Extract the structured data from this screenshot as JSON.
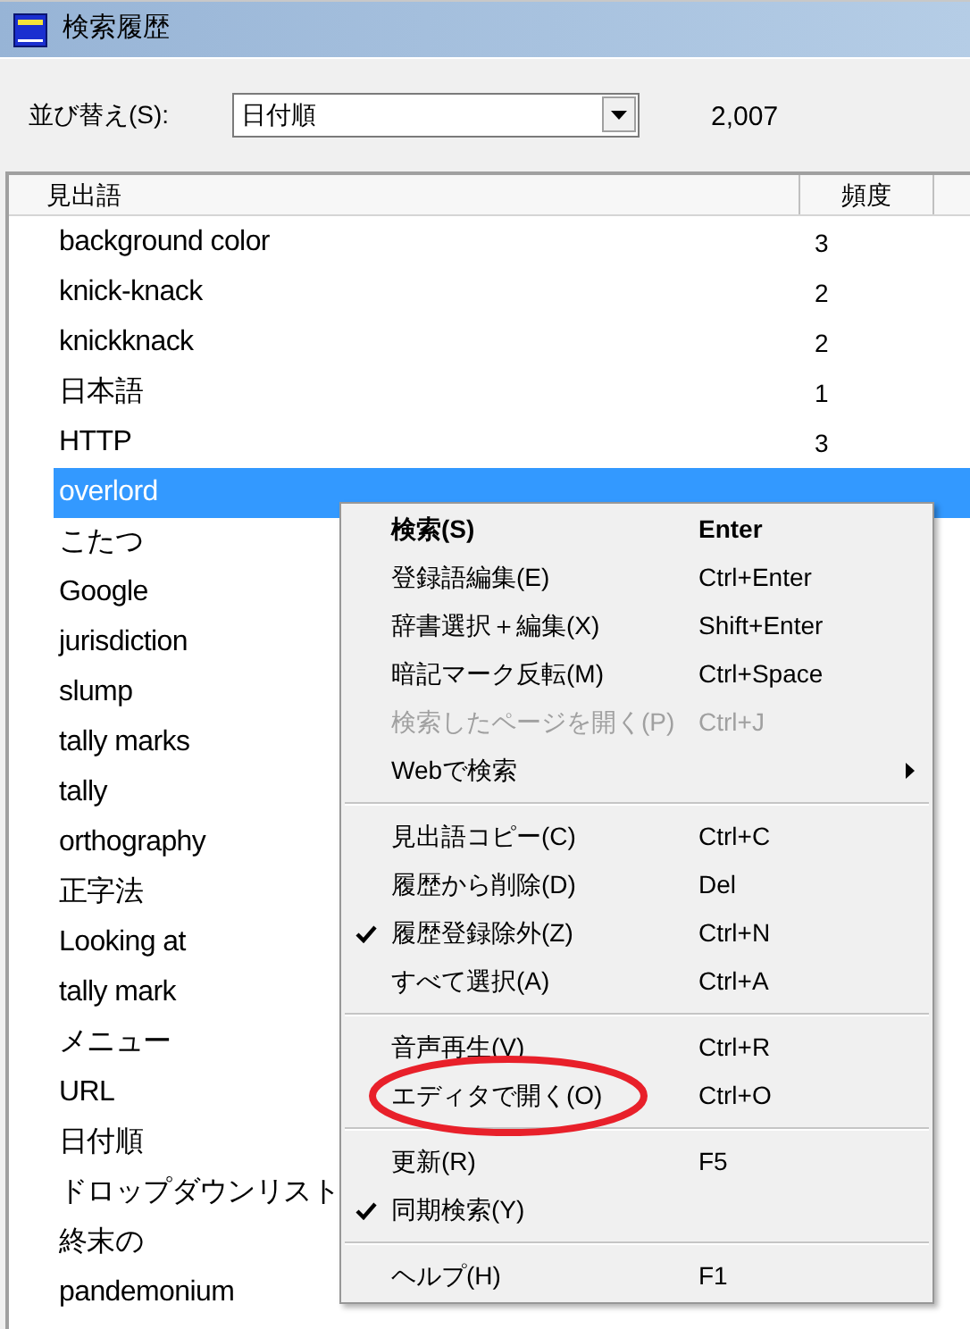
{
  "window": {
    "title": "検索履歴"
  },
  "sort": {
    "label": "並び替え(S):",
    "value": "日付順",
    "count": "2,007"
  },
  "table": {
    "columns": [
      "見出語",
      "頻度"
    ],
    "rows": [
      {
        "word": "background color",
        "freq": "3",
        "selected": false
      },
      {
        "word": "knick-knack",
        "freq": "2",
        "selected": false
      },
      {
        "word": "knickknack",
        "freq": "2",
        "selected": false
      },
      {
        "word": "日本語",
        "freq": "1",
        "selected": false
      },
      {
        "word": "HTTP",
        "freq": "3",
        "selected": false
      },
      {
        "word": "overlord",
        "selected": true
      },
      {
        "word": "こたつ",
        "selected": false
      },
      {
        "word": "Google",
        "selected": false
      },
      {
        "word": "jurisdiction",
        "selected": false
      },
      {
        "word": "slump",
        "selected": false
      },
      {
        "word": "tally marks",
        "selected": false
      },
      {
        "word": "tally",
        "selected": false
      },
      {
        "word": "orthography",
        "selected": false
      },
      {
        "word": "正字法",
        "selected": false
      },
      {
        "word": "Looking at",
        "selected": false
      },
      {
        "word": "tally mark",
        "selected": false
      },
      {
        "word": "メニュー",
        "selected": false
      },
      {
        "word": "URL",
        "selected": false
      },
      {
        "word": "日付順",
        "selected": false
      },
      {
        "word": "ドロップダウンリスト",
        "selected": false
      },
      {
        "word": "終末の",
        "selected": false
      },
      {
        "word": "pandemonium",
        "selected": false
      }
    ]
  },
  "context_menu": [
    {
      "kind": "item",
      "label": "検索(S)",
      "shortcut": "Enter",
      "default": true,
      "checked": false,
      "disabled": false,
      "submenu": false,
      "circled": false
    },
    {
      "kind": "item",
      "label": "登録語編集(E)",
      "shortcut": "Ctrl+Enter",
      "default": false,
      "checked": false,
      "disabled": false,
      "submenu": false,
      "circled": false
    },
    {
      "kind": "item",
      "label": "辞書選択＋編集(X)",
      "shortcut": "Shift+Enter",
      "default": false,
      "checked": false,
      "disabled": false,
      "submenu": false,
      "circled": false
    },
    {
      "kind": "item",
      "label": "暗記マーク反転(M)",
      "shortcut": "Ctrl+Space",
      "default": false,
      "checked": false,
      "disabled": false,
      "submenu": false,
      "circled": false
    },
    {
      "kind": "item",
      "label": "検索したページを開く(P)",
      "shortcut": "Ctrl+J",
      "default": false,
      "checked": false,
      "disabled": true,
      "submenu": false,
      "circled": false
    },
    {
      "kind": "item",
      "label": "Webで検索",
      "default": false,
      "checked": false,
      "disabled": false,
      "submenu": true,
      "circled": false
    },
    {
      "kind": "separator"
    },
    {
      "kind": "item",
      "label": "見出語コピー(C)",
      "shortcut": "Ctrl+C",
      "default": false,
      "checked": false,
      "disabled": false,
      "submenu": false,
      "circled": false
    },
    {
      "kind": "item",
      "label": "履歴から削除(D)",
      "shortcut": "Del",
      "default": false,
      "checked": false,
      "disabled": false,
      "submenu": false,
      "circled": false
    },
    {
      "kind": "item",
      "label": "履歴登録除外(Z)",
      "shortcut": "Ctrl+N",
      "default": false,
      "checked": true,
      "disabled": false,
      "submenu": false,
      "circled": false
    },
    {
      "kind": "item",
      "label": "すべて選択(A)",
      "shortcut": "Ctrl+A",
      "default": false,
      "checked": false,
      "disabled": false,
      "submenu": false,
      "circled": false
    },
    {
      "kind": "separator"
    },
    {
      "kind": "item",
      "label": "音声再生(V)",
      "shortcut": "Ctrl+R",
      "default": false,
      "checked": false,
      "disabled": false,
      "submenu": false,
      "circled": false
    },
    {
      "kind": "item",
      "label": "エディタで開く(O)",
      "shortcut": "Ctrl+O",
      "default": false,
      "checked": false,
      "disabled": false,
      "submenu": false,
      "circled": true
    },
    {
      "kind": "separator"
    },
    {
      "kind": "item",
      "label": "更新(R)",
      "shortcut": "F5",
      "default": false,
      "checked": false,
      "disabled": false,
      "submenu": false,
      "circled": false
    },
    {
      "kind": "item",
      "label": "同期検索(Y)",
      "default": false,
      "checked": true,
      "disabled": false,
      "submenu": false,
      "circled": false
    },
    {
      "kind": "separator"
    },
    {
      "kind": "item",
      "label": "ヘルプ(H)",
      "shortcut": "F1",
      "default": false,
      "checked": false,
      "disabled": false,
      "submenu": false,
      "circled": false
    }
  ]
}
